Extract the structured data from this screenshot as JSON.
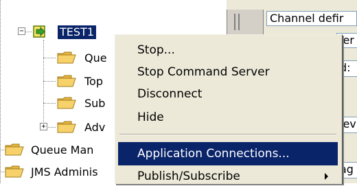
{
  "tree": {
    "root": {
      "label": "TEST1"
    },
    "children": [
      {
        "label": "Que"
      },
      {
        "label": "Top"
      },
      {
        "label": "Sub"
      },
      {
        "label": "Adv"
      }
    ],
    "siblings": [
      {
        "label": "Queue Man"
      },
      {
        "label": "JMS Adminis"
      }
    ]
  },
  "right_pane": {
    "field1": "Channel defir",
    "field2": "ler",
    "field3": "d:",
    "field4": "iev",
    "field5": "ag"
  },
  "context_menu": {
    "items": [
      {
        "label": "Stop..."
      },
      {
        "label": "Stop Command Server"
      },
      {
        "label": "Disconnect"
      },
      {
        "label": "Hide"
      },
      {
        "label": "Application Connections..."
      },
      {
        "label": "Publish/Subscribe"
      }
    ]
  },
  "colors": {
    "selection": "#0a246a",
    "menu_bg": "#ece9d8",
    "folder": "#f7d26a"
  }
}
